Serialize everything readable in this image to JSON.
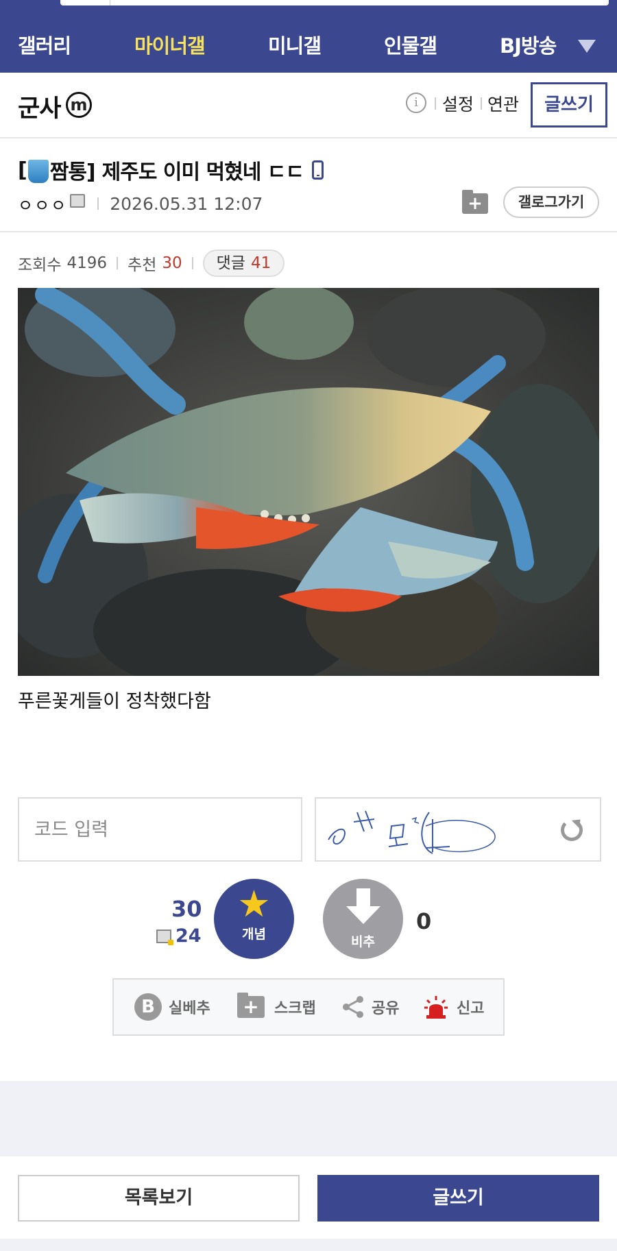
{
  "nav": {
    "items": [
      {
        "label": "갤러리",
        "active": false
      },
      {
        "label": "마이너갤",
        "active": true
      },
      {
        "label": "미니갤",
        "active": false
      },
      {
        "label": "인물갤",
        "active": false
      },
      {
        "label": "BJ방송",
        "active": false
      }
    ],
    "more_icon": "triangle-down-icon"
  },
  "gallery": {
    "name": "군사",
    "badge": "m",
    "info_icon": "i",
    "settings_label": "설정",
    "related_label": "연관",
    "write_label": "글쓰기"
  },
  "post": {
    "title_prefix": "[",
    "title_tag": "짬통]",
    "title_text": "제주도 이미 먹혔네 ㄷㄷ",
    "author": "ㅇㅇㅇ",
    "date": "2026.05.31 12:07",
    "gallog_label": "갤로그가기",
    "views_label": "조회수",
    "views": "4196",
    "recommend_label": "추천",
    "recommend": "30",
    "comments_label": "댓글",
    "comments": "41",
    "body": "푸른꽃게들이 정착했다함"
  },
  "captcha": {
    "placeholder": "코드 입력",
    "refresh_icon": "refresh-icon"
  },
  "vote": {
    "up_count": "30",
    "fixed_count": "24",
    "up_label": "개념",
    "down_label": "비추",
    "down_count": "0"
  },
  "actions": {
    "best_badge": "B",
    "best_label": "실베추",
    "scrap_label": "스크랩",
    "share_label": "공유",
    "report_label": "신고"
  },
  "footer": {
    "list_label": "목록보기",
    "write_label": "글쓰기"
  },
  "colors": {
    "brand": "#3b4890",
    "active_nav": "#f6e25d",
    "count_red": "#c0392b"
  }
}
